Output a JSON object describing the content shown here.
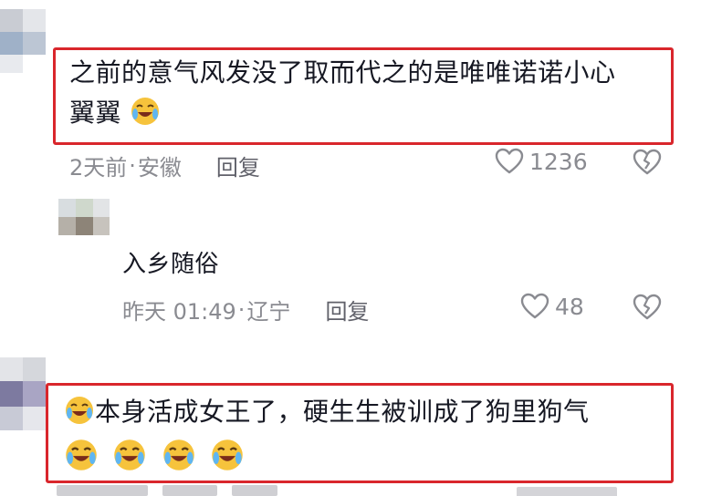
{
  "comments": [
    {
      "text_line1": "之前的意气风发没了取而代之的是唯唯诺诺小心",
      "text_line2": "翼翼",
      "time": "2天前",
      "location": "安徽",
      "reply_label": "回复",
      "likes": "1236",
      "highlighted": true,
      "emoji": "crying-laughing"
    },
    {
      "text_line1": "入乡随俗",
      "time": "昨天 01:49",
      "location": "辽宁",
      "reply_label": "回复",
      "likes": "48",
      "is_reply": true
    },
    {
      "text_line1": "本身活成女王了，硬生生被训成了狗里狗气",
      "highlighted": true,
      "emoji": "crying-laughing",
      "emoji_count_line2": 4
    }
  ],
  "meta_separator": "·",
  "colors": {
    "highlight_border": "#d9262c",
    "meta_text": "#8a8b91",
    "body_text": "#161823"
  },
  "icons": {
    "like": "heart-outline-icon",
    "dislike": "broken-heart-icon",
    "emoji": "crying-laughing-emoji-icon"
  }
}
